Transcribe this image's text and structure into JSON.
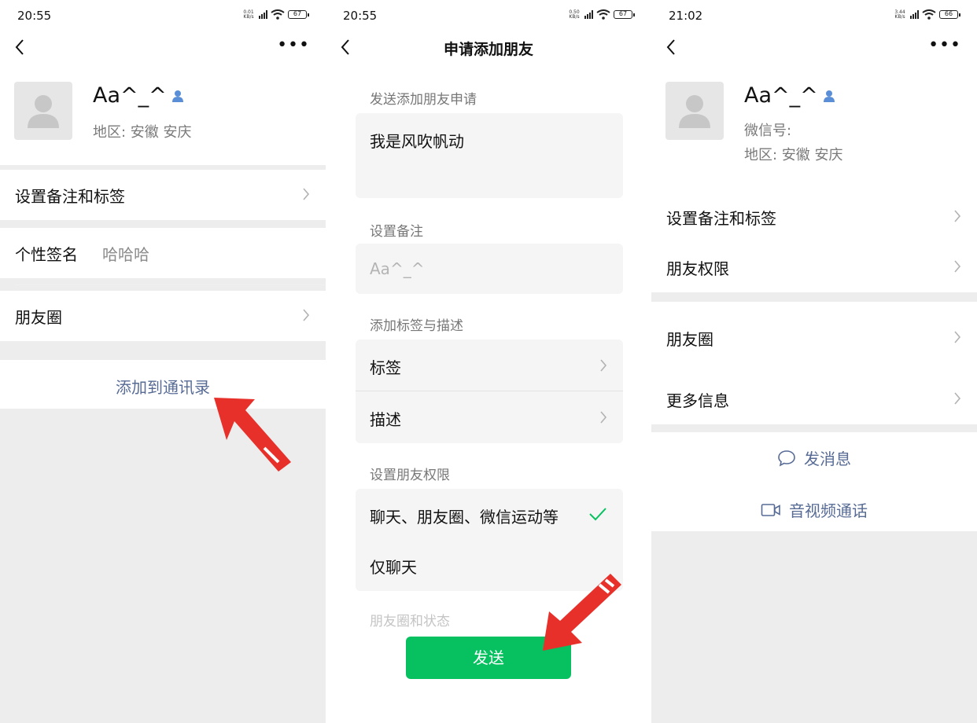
{
  "colors": {
    "accent_link": "#576b95",
    "send_green": "#07c160",
    "arrow_red": "#e8302b",
    "check_green": "#07c160"
  },
  "panel1": {
    "status": {
      "time": "20:55",
      "speed": "0.01 KB/s",
      "battery": "67"
    },
    "nickname": "Aa^_^",
    "region": "地区:  安徽  安庆",
    "rows": {
      "remark": "设置备注和标签",
      "signature_label": "个性签名",
      "signature_value": "哈哈哈",
      "moments": "朋友圈"
    },
    "add_contact": "添加到通讯录"
  },
  "panel2": {
    "status": {
      "time": "20:55",
      "speed": "0.50 KB/s",
      "battery": "67"
    },
    "title": "申请添加朋友",
    "section_request": "发送添加朋友申请",
    "request_message": "我是风吹帆动",
    "section_remark": "设置备注",
    "remark_placeholder": "Aa^_^",
    "section_tags": "添加标签与描述",
    "tags_label": "标签",
    "description_label": "描述",
    "section_permission": "设置朋友权限",
    "permission_all": "聊天、朋友圈、微信运动等",
    "permission_chat_only": "仅聊天",
    "section_moments": "朋友圈和状态",
    "send_button": "发送"
  },
  "panel3": {
    "status": {
      "time": "21:02",
      "speed": "3.44 KB/s",
      "battery": "66"
    },
    "nickname": "Aa^_^",
    "wechat_id": "微信号:",
    "region": "地区:  安徽  安庆",
    "rows": {
      "remark": "设置备注和标签",
      "permission": "朋友权限",
      "moments": "朋友圈",
      "more_info": "更多信息"
    },
    "send_message": "发消息",
    "video_call": "音视频通话"
  }
}
